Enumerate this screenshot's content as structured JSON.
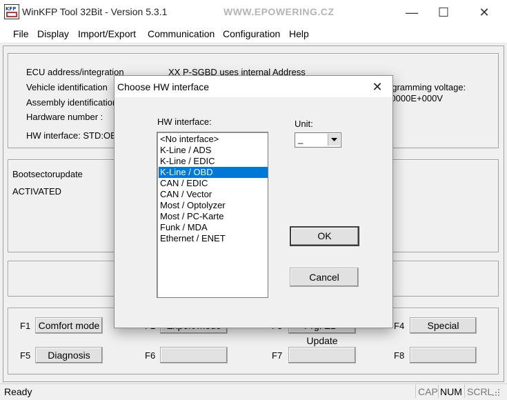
{
  "window": {
    "title": "WinKFP Tool 32Bit - Version 5.3.1",
    "watermark": "WWW.EPOWERING.CZ",
    "icon_name": "winkfp-app-icon",
    "controls": {
      "minimize": "—",
      "maximize": "☐",
      "close": "✕"
    }
  },
  "menu": [
    "File",
    "Display",
    "Import/Export",
    "Communication",
    "Configuration",
    "Help"
  ],
  "info": {
    "ecu_label": "ECU address/integration",
    "ecu_value": "XX   P-SGBD uses internal Address",
    "vehicle_label": "Vehicle identification",
    "assembly_label": "Assembly identification",
    "hardware_label": "Hardware number :",
    "hw_interface_label": "HW interface:  STD:OBD",
    "programming_voltage_label": "Programming voltage:",
    "programming_voltage_value": "+0.0000E+000V"
  },
  "boot": {
    "title": "Bootsectorupdate",
    "status": "ACTIVATED"
  },
  "function_keys": {
    "f1": {
      "key": "F1",
      "label": "Comfort mode"
    },
    "f2": {
      "key": "F2",
      "label": "Expert mode"
    },
    "f3": {
      "key": "F3",
      "label": "Prg. ZB-Update"
    },
    "f4": {
      "key": "F4",
      "label": "Special"
    },
    "f5": {
      "key": "F5",
      "label": "Diagnosis"
    },
    "f6": {
      "key": "F6",
      "label": ""
    },
    "f7": {
      "key": "F7",
      "label": ""
    },
    "f8": {
      "key": "F8",
      "label": ""
    }
  },
  "status": {
    "text": "Ready",
    "cap": "CAP",
    "num": "NUM",
    "scrl": "SCRL"
  },
  "dialog": {
    "title": "Choose HW interface",
    "close": "✕",
    "list_label": "HW interface:",
    "items": [
      "<No interface>",
      "K-Line / ADS",
      "K-Line / EDIC",
      "K-Line / OBD",
      "CAN / EDIC",
      "CAN / Vector",
      "Most / Optolyzer",
      "Most / PC-Karte",
      "Funk / MDA",
      "Ethernet / ENET"
    ],
    "selected": "K-Line / OBD",
    "unit_label": "Unit:",
    "unit_value": "_",
    "ok": "OK",
    "cancel": "Cancel"
  }
}
